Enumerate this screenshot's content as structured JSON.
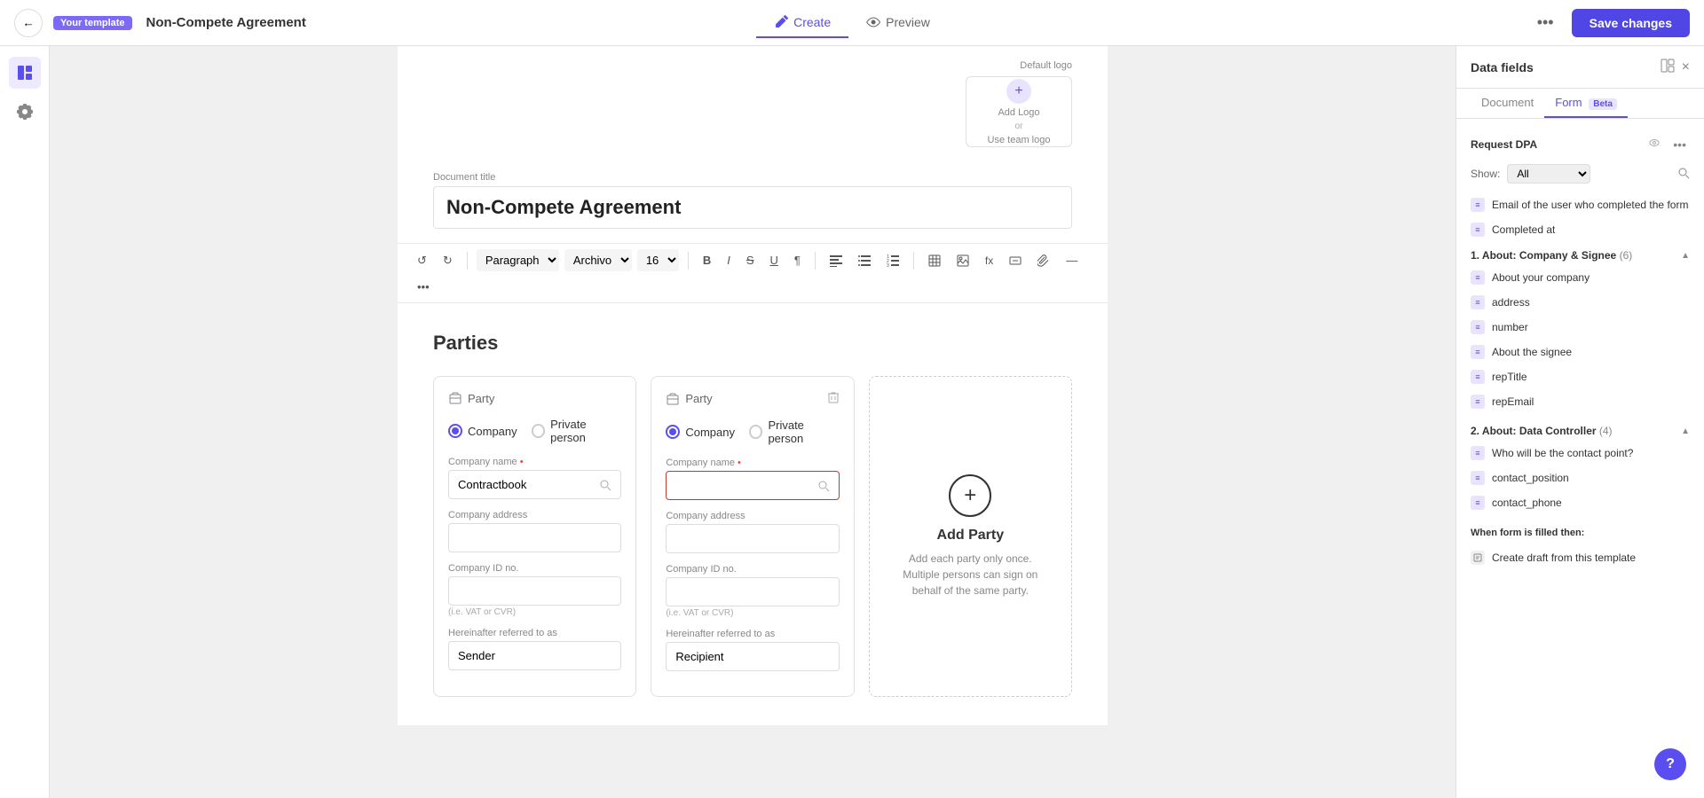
{
  "topbar": {
    "back_label": "←",
    "template_badge": "Your template",
    "doc_title": "Non-Compete Agreement",
    "tabs": [
      {
        "id": "create",
        "label": "Create",
        "active": true
      },
      {
        "id": "preview",
        "label": "Preview",
        "active": false
      }
    ],
    "more_label": "•••",
    "save_label": "Save changes"
  },
  "toolbar": {
    "undo": "↺",
    "redo": "↻",
    "paragraph_label": "Paragraph",
    "font_label": "Archivo",
    "size_label": "16",
    "bold": "B",
    "italic": "I",
    "strikethrough": "S",
    "underline": "U",
    "pilcrow": "¶"
  },
  "logo": {
    "label": "Default logo",
    "add_logo_text": "Add Logo",
    "or_text": "or",
    "use_team_logo": "Use team logo"
  },
  "document": {
    "title_label": "Document title",
    "title_value": "Non-Compete Agreement",
    "parties_heading": "Parties"
  },
  "parties": [
    {
      "id": "party1",
      "label": "Party",
      "type_company": "Company",
      "type_private": "Private person",
      "selected": "company",
      "company_name_label": "Company name",
      "company_name_required": true,
      "company_name_value": "Contractbook",
      "company_address_label": "Company address",
      "company_address_value": "",
      "company_id_label": "Company ID no.",
      "company_id_value": "",
      "company_id_hint": "(i.e. VAT or CVR)",
      "referred_label": "Hereinafter referred to as",
      "referred_value": "Sender"
    },
    {
      "id": "party2",
      "label": "Party",
      "type_company": "Company",
      "type_private": "Private person",
      "selected": "company",
      "company_name_label": "Company name",
      "company_name_required": true,
      "company_name_value": "",
      "company_address_label": "Company address",
      "company_address_value": "",
      "company_id_label": "Company ID no.",
      "company_id_value": "",
      "company_id_hint": "(i.e. VAT or CVR)",
      "referred_label": "Hereinafter referred to as",
      "referred_value": "Recipient"
    }
  ],
  "add_party": {
    "icon": "+",
    "title": "Add Party",
    "description": "Add each party only once.\nMultiple persons can sign on\nbehalf of the same party."
  },
  "right_panel": {
    "title": "Data fields",
    "close_icon": "×",
    "tabs": [
      {
        "id": "document",
        "label": "Document",
        "active": false
      },
      {
        "id": "form",
        "label": "Form",
        "active": true,
        "badge": "Beta"
      }
    ],
    "request_dpa_label": "Request DPA",
    "show_label": "Show:",
    "show_value": "All",
    "top_fields": [
      {
        "id": "email_completed",
        "label": "Email of the user who completed the form"
      },
      {
        "id": "completed_at",
        "label": "Completed at"
      }
    ],
    "sections": [
      {
        "id": "company_signee",
        "title": "1. About: Company & Signee",
        "count": 6,
        "expanded": true,
        "fields": [
          {
            "id": "about_company",
            "label": "About your company"
          },
          {
            "id": "address",
            "label": "address"
          },
          {
            "id": "number",
            "label": "number"
          },
          {
            "id": "about_signee",
            "label": "About the signee"
          },
          {
            "id": "rep_title",
            "label": "repTitle"
          },
          {
            "id": "rep_email",
            "label": "repEmail"
          }
        ]
      },
      {
        "id": "data_controller",
        "title": "2. About: Data Controller",
        "count": 4,
        "expanded": true,
        "fields": [
          {
            "id": "contact_point",
            "label": "Who will be the contact point?"
          },
          {
            "id": "contact_position",
            "label": "contact_position"
          },
          {
            "id": "contact_phone",
            "label": "contact_phone"
          }
        ]
      }
    ],
    "when_form_filled_label": "When form is filled then:",
    "when_form_items": [
      {
        "id": "create_draft",
        "label": "Create draft from this template"
      }
    ]
  },
  "help": {
    "label": "?"
  }
}
